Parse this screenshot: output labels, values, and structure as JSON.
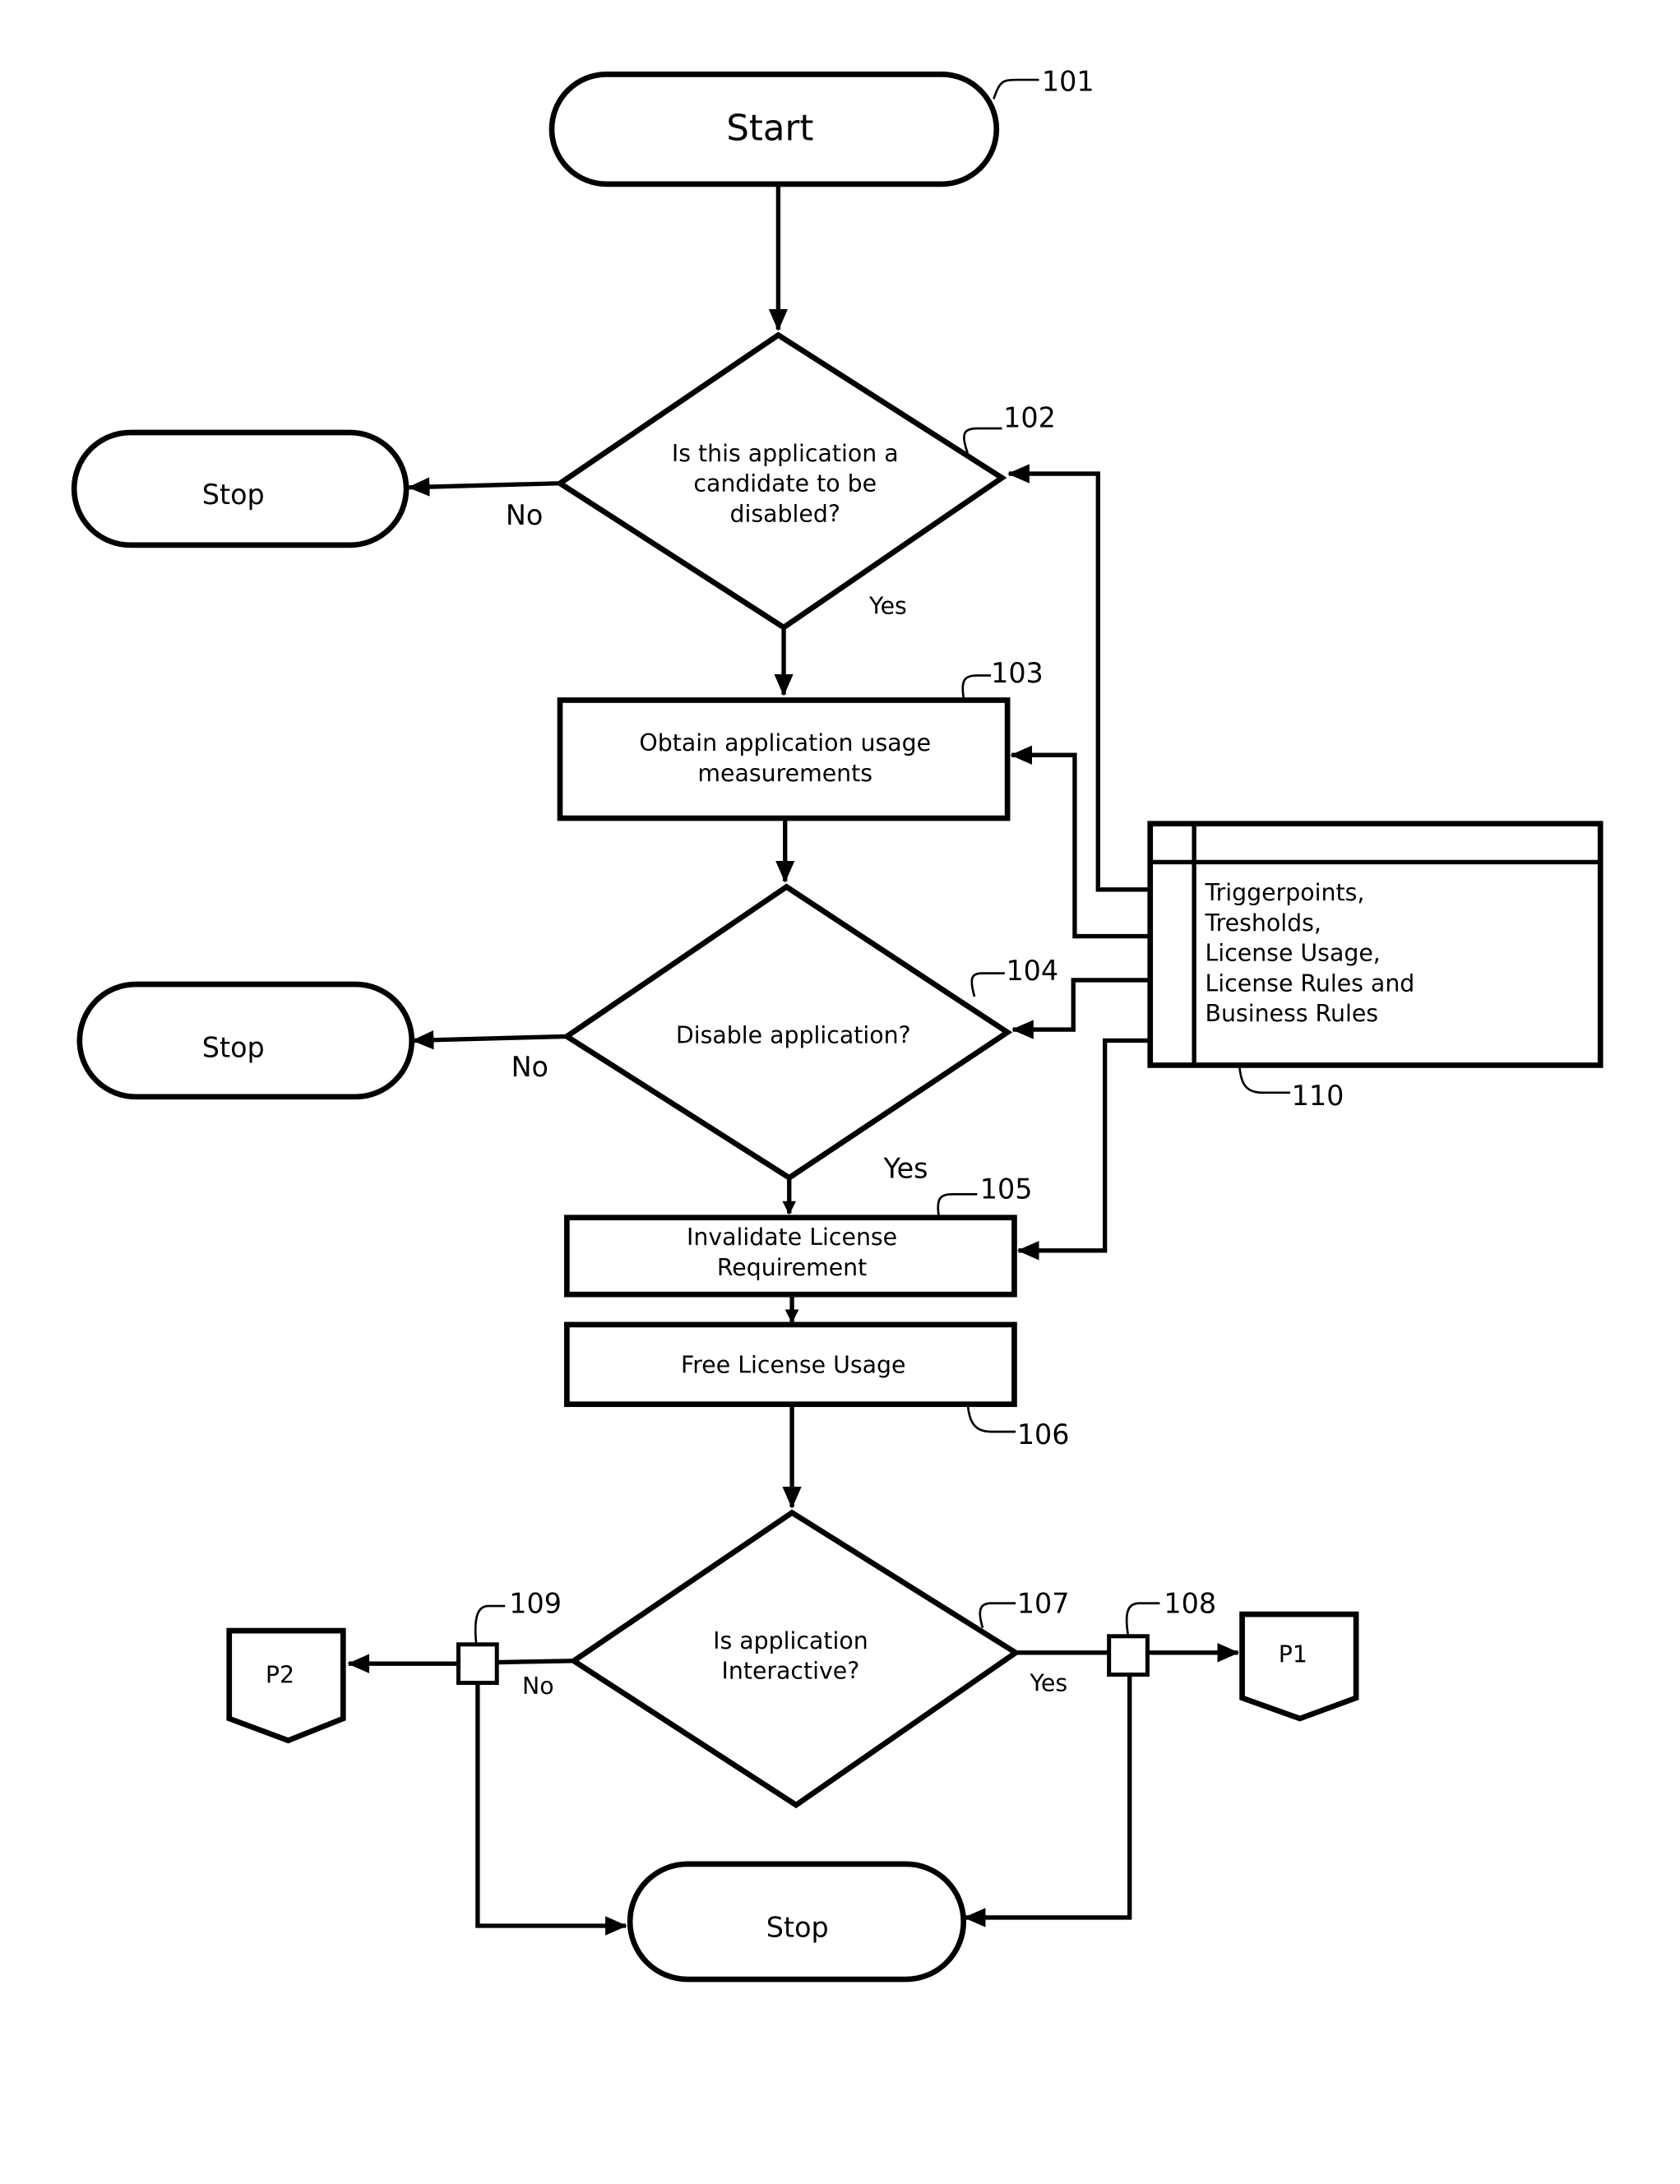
{
  "diagram": {
    "type": "flowchart",
    "nodes": {
      "start": {
        "ref": "101",
        "label": "Start"
      },
      "decision_candidate": {
        "ref": "102",
        "lines": [
          "Is this application a",
          "candidate to be",
          "disabled?"
        ]
      },
      "stop_1": {
        "label": "Stop"
      },
      "obtain_usage": {
        "ref": "103",
        "lines": [
          "Obtain application usage",
          "measurements"
        ]
      },
      "decision_disable": {
        "ref": "104",
        "label": "Disable application?"
      },
      "stop_2": {
        "label": "Stop"
      },
      "invalidate": {
        "ref": "105",
        "lines": [
          "Invalidate License",
          "Requirement"
        ]
      },
      "free_usage": {
        "ref": "106",
        "label": "Free License Usage"
      },
      "decision_interactive": {
        "ref": "107",
        "lines": [
          "Is application",
          "Interactive?"
        ]
      },
      "junction_yes": {
        "ref": "108"
      },
      "junction_no": {
        "ref": "109"
      },
      "offpage_p1": {
        "label": "P1"
      },
      "offpage_p2": {
        "label": "P2"
      },
      "stop_3": {
        "label": "Stop"
      },
      "datastore": {
        "ref": "110",
        "lines": [
          "Triggerpoints,",
          "Tresholds,",
          "License Usage,",
          "License Rules and",
          "Business Rules"
        ]
      }
    },
    "edge_labels": {
      "d102_no": "No",
      "d102_yes": "Yes",
      "d104_no": "No",
      "d104_yes": "Yes",
      "d107_no": "No",
      "d107_yes": "Yes"
    }
  }
}
